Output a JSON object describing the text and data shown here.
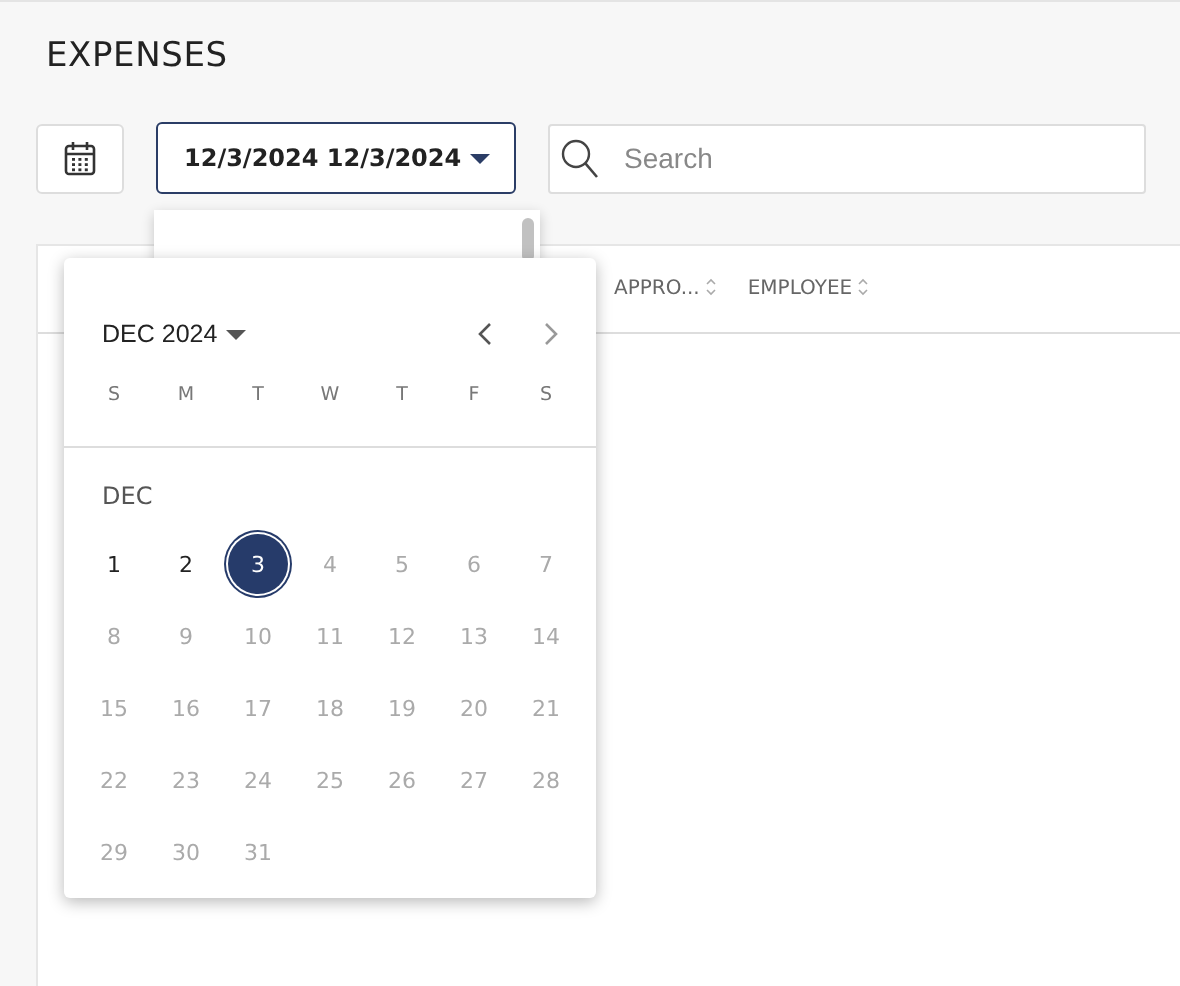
{
  "page": {
    "title": "EXPENSES"
  },
  "toolbar": {
    "date_range": "12/3/2024 12/3/2024",
    "search": {
      "placeholder": "Search"
    }
  },
  "table": {
    "columns": [
      "APPRO...",
      "EMPLOYEE"
    ]
  },
  "calendar": {
    "month_label": "DEC 2024",
    "weekdays": [
      "S",
      "M",
      "T",
      "W",
      "T",
      "F",
      "S"
    ],
    "section": "DEC",
    "days": [
      {
        "label": "1",
        "selected": false,
        "disabled": false
      },
      {
        "label": "2",
        "selected": false,
        "disabled": false
      },
      {
        "label": "3",
        "selected": true,
        "disabled": false
      },
      {
        "label": "4",
        "selected": false,
        "disabled": true
      },
      {
        "label": "5",
        "selected": false,
        "disabled": true
      },
      {
        "label": "6",
        "selected": false,
        "disabled": true
      },
      {
        "label": "7",
        "selected": false,
        "disabled": true
      },
      {
        "label": "8",
        "selected": false,
        "disabled": true
      },
      {
        "label": "9",
        "selected": false,
        "disabled": true
      },
      {
        "label": "10",
        "selected": false,
        "disabled": true
      },
      {
        "label": "11",
        "selected": false,
        "disabled": true
      },
      {
        "label": "12",
        "selected": false,
        "disabled": true
      },
      {
        "label": "13",
        "selected": false,
        "disabled": true
      },
      {
        "label": "14",
        "selected": false,
        "disabled": true
      },
      {
        "label": "15",
        "selected": false,
        "disabled": true
      },
      {
        "label": "16",
        "selected": false,
        "disabled": true
      },
      {
        "label": "17",
        "selected": false,
        "disabled": true
      },
      {
        "label": "18",
        "selected": false,
        "disabled": true
      },
      {
        "label": "19",
        "selected": false,
        "disabled": true
      },
      {
        "label": "20",
        "selected": false,
        "disabled": true
      },
      {
        "label": "21",
        "selected": false,
        "disabled": true
      },
      {
        "label": "22",
        "selected": false,
        "disabled": true
      },
      {
        "label": "23",
        "selected": false,
        "disabled": true
      },
      {
        "label": "24",
        "selected": false,
        "disabled": true
      },
      {
        "label": "25",
        "selected": false,
        "disabled": true
      },
      {
        "label": "26",
        "selected": false,
        "disabled": true
      },
      {
        "label": "27",
        "selected": false,
        "disabled": true
      },
      {
        "label": "28",
        "selected": false,
        "disabled": true
      },
      {
        "label": "29",
        "selected": false,
        "disabled": true
      },
      {
        "label": "30",
        "selected": false,
        "disabled": true
      },
      {
        "label": "31",
        "selected": false,
        "disabled": true
      }
    ]
  }
}
